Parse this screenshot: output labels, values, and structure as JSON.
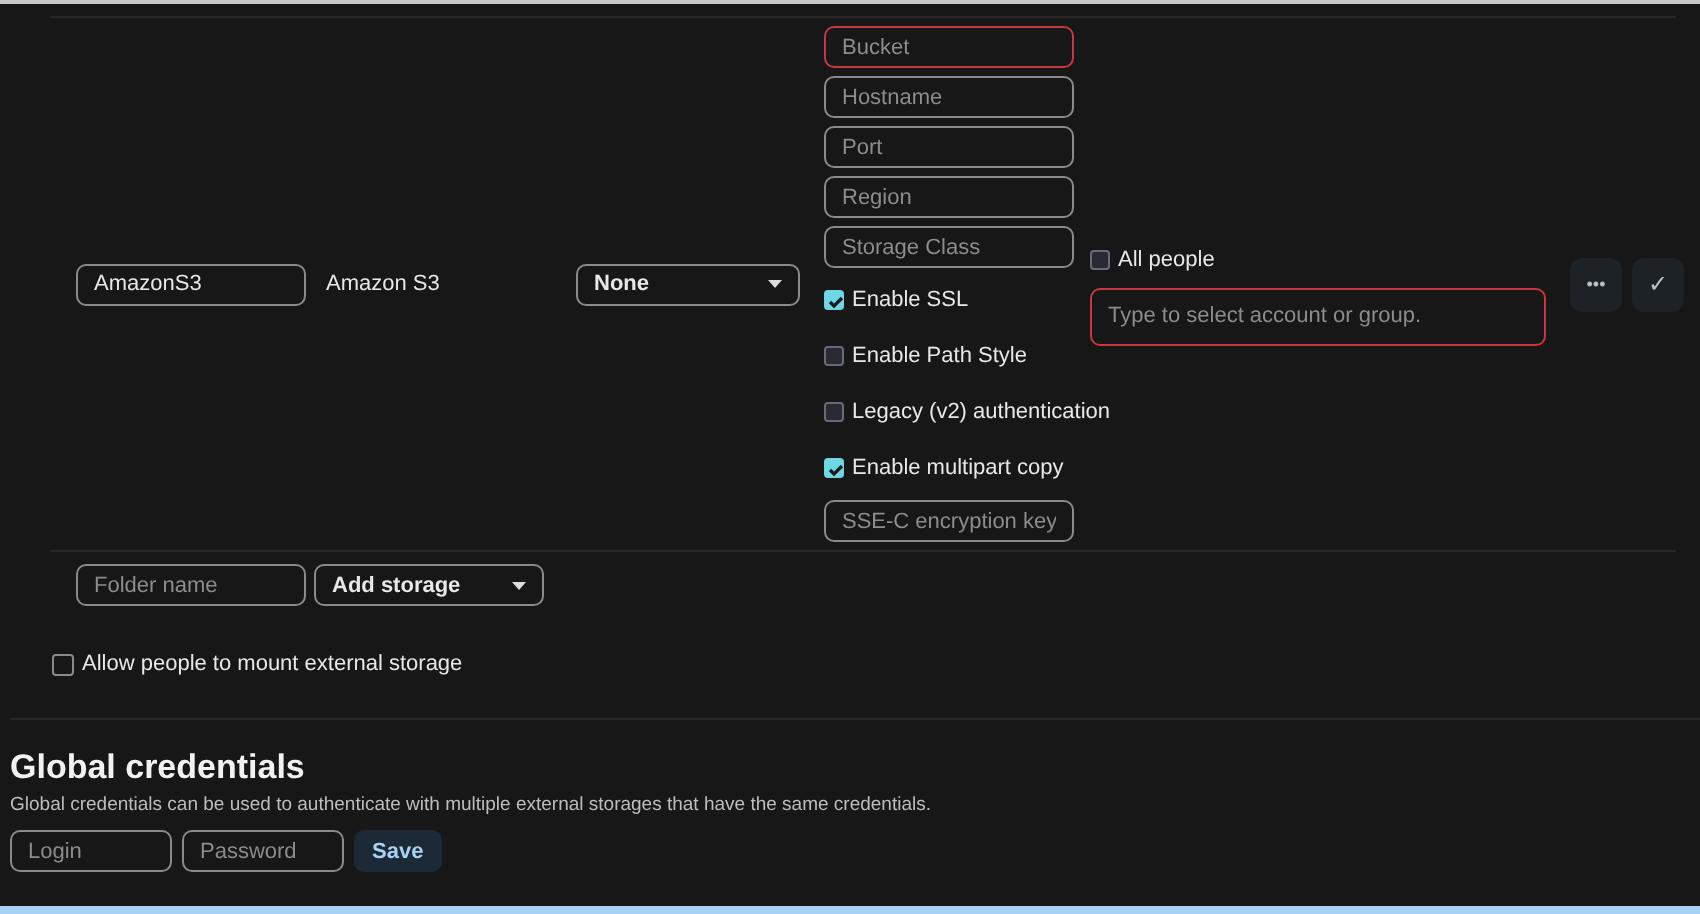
{
  "mounts": [
    {
      "folder_name": "AmazonS3",
      "backend": "Amazon S3",
      "authentication": "None",
      "configuration": [
        {
          "kind": "input",
          "placeholder": "Bucket",
          "invalid": true
        },
        {
          "kind": "input",
          "placeholder": "Hostname",
          "invalid": false
        },
        {
          "kind": "input",
          "placeholder": "Port",
          "invalid": false
        },
        {
          "kind": "input",
          "placeholder": "Region",
          "invalid": false
        },
        {
          "kind": "input",
          "placeholder": "Storage Class",
          "invalid": false
        },
        {
          "kind": "checkbox",
          "label": "Enable SSL",
          "checked": true
        },
        {
          "kind": "checkbox",
          "label": "Enable Path Style",
          "checked": false
        },
        {
          "kind": "checkbox",
          "label": "Legacy (v2) authentication",
          "checked": false
        },
        {
          "kind": "checkbox",
          "label": "Enable multipart copy",
          "checked": true
        },
        {
          "kind": "input",
          "placeholder": "SSE-C encryption key",
          "invalid": false
        }
      ],
      "applicable": {
        "all_people_label": "All people",
        "all_people_checked": false,
        "placeholder": "Type to select account or group.",
        "invalid": true
      },
      "actions": [
        {
          "kind": "more",
          "label": "•••"
        },
        {
          "kind": "save",
          "label": "✓"
        }
      ]
    }
  ],
  "new_mount": {
    "folder_placeholder": "Folder name",
    "add_storage": "Add storage"
  },
  "allow_user_mounting": {
    "label": "Allow people to mount external storage",
    "checked": false
  },
  "global_credentials": {
    "title": "Global credentials",
    "description": "Global credentials can be used to authenticate with multiple external storages that have the same credentials.",
    "login_placeholder": "Login",
    "password_placeholder": "Password",
    "save": "Save"
  }
}
